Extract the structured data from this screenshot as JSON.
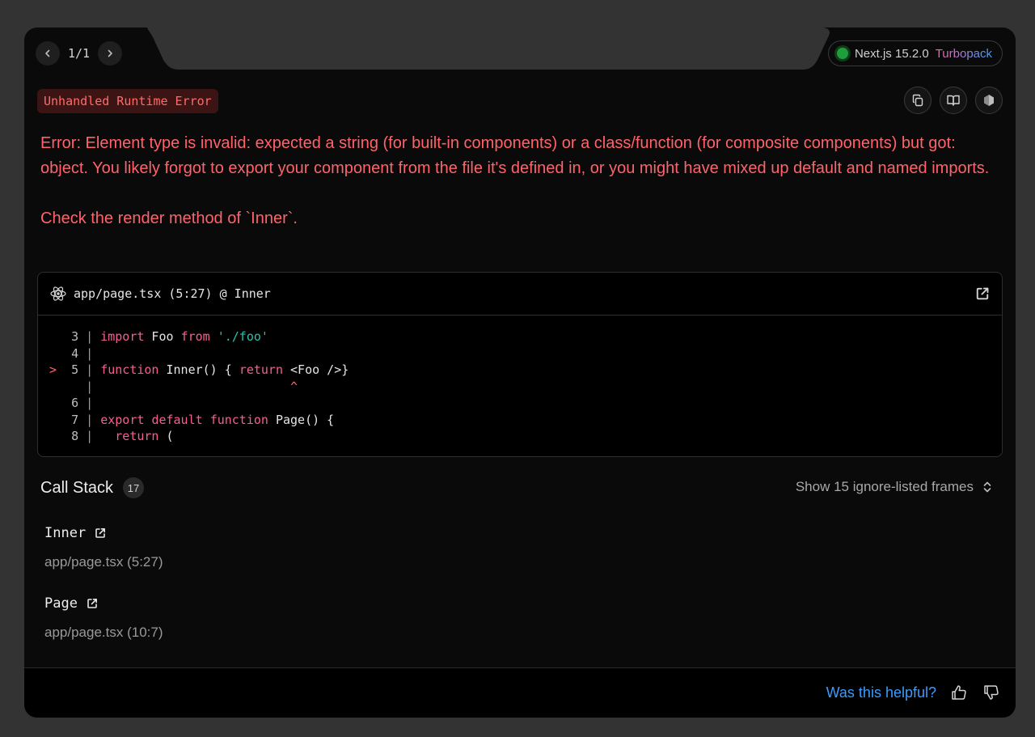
{
  "nav": {
    "counter": "1/1",
    "prev_icon": "chevron-left-icon",
    "next_icon": "chevron-right-icon"
  },
  "version": {
    "label": "Next.js 15.2.0",
    "bundler": "Turbopack",
    "status_color": "#1e9e3d"
  },
  "error": {
    "badge": "Unhandled Runtime Error",
    "message": "Error: Element type is invalid: expected a string (for built-in components) or a class/function (for composite components) but got: object. You likely forgot to export your component from the file it's defined in, or you might have mixed up default and named imports.\n\nCheck the render method of `Inner`.",
    "color": "#ff6369"
  },
  "toolbar": {
    "copy_icon": "copy-icon",
    "docs_icon": "book-icon",
    "nodejs_icon": "nodejs-hexagon-icon"
  },
  "code_frame": {
    "file": "app/page.tsx (5:27) @ Inner",
    "react_icon": "react-icon",
    "open_icon": "external-link-icon",
    "lines": [
      {
        "marker": " ",
        "num": "3",
        "tokens": [
          {
            "t": "kw",
            "v": "import"
          },
          {
            "t": "plain",
            "v": " Foo "
          },
          {
            "t": "kw",
            "v": "from"
          },
          {
            "t": "plain",
            "v": " "
          },
          {
            "t": "str",
            "v": "'./foo'"
          }
        ]
      },
      {
        "marker": " ",
        "num": "4",
        "tokens": []
      },
      {
        "marker": ">",
        "num": "5",
        "tokens": [
          {
            "t": "kw",
            "v": "function"
          },
          {
            "t": "plain",
            "v": " Inner() { "
          },
          {
            "t": "kw",
            "v": "return"
          },
          {
            "t": "plain",
            "v": " <Foo />}"
          }
        ]
      },
      {
        "marker": " ",
        "num": " ",
        "tokens": [
          {
            "t": "plain",
            "v": "                          "
          },
          {
            "t": "caret",
            "v": "^"
          }
        ]
      },
      {
        "marker": " ",
        "num": "6",
        "tokens": []
      },
      {
        "marker": " ",
        "num": "7",
        "tokens": [
          {
            "t": "kw",
            "v": "export"
          },
          {
            "t": "plain",
            "v": " "
          },
          {
            "t": "kw",
            "v": "default"
          },
          {
            "t": "plain",
            "v": " "
          },
          {
            "t": "kw",
            "v": "function"
          },
          {
            "t": "plain",
            "v": " Page() {"
          }
        ]
      },
      {
        "marker": " ",
        "num": "8",
        "tokens": [
          {
            "t": "plain",
            "v": "  "
          },
          {
            "t": "kw",
            "v": "return"
          },
          {
            "t": "plain",
            "v": " ("
          }
        ]
      }
    ]
  },
  "call_stack": {
    "title": "Call Stack",
    "count": "17",
    "toggle_label": "Show 15 ignore-listed frames",
    "frames": [
      {
        "name": "Inner",
        "location": "app/page.tsx (5:27)"
      },
      {
        "name": "Page",
        "location": "app/page.tsx (10:7)"
      }
    ]
  },
  "footer": {
    "helpful_label": "Was this helpful?",
    "thumbs_up_icon": "thumbs-up-icon",
    "thumbs_down_icon": "thumbs-down-icon",
    "link_color": "#3b9cff"
  }
}
